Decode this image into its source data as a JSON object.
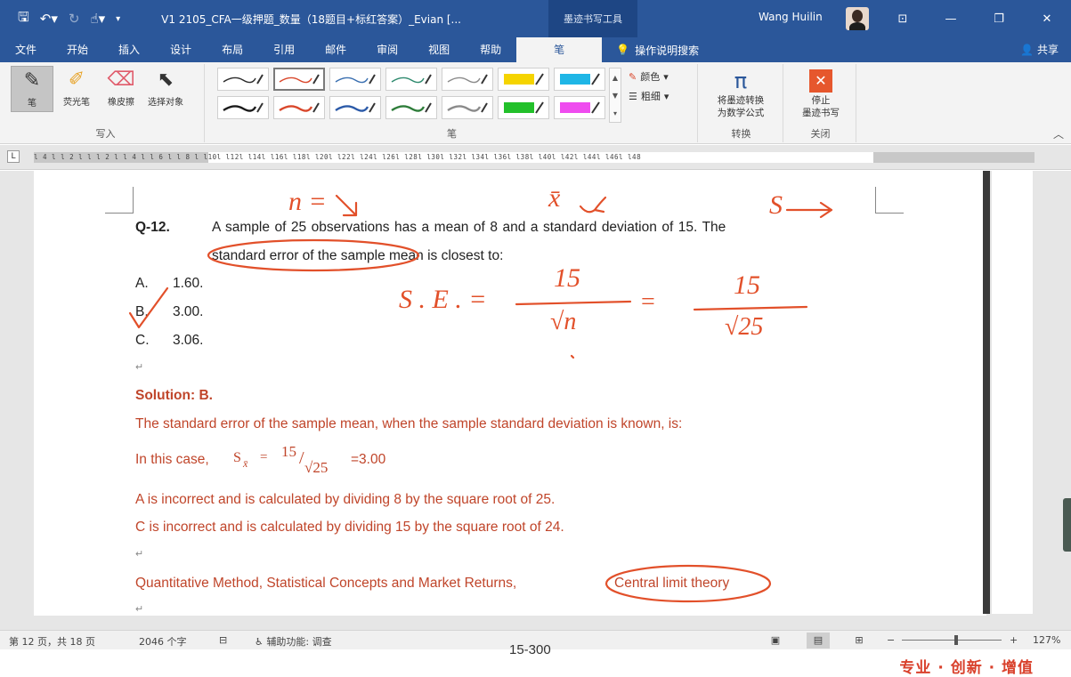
{
  "window": {
    "doc_title": "V1 2105_CFA一级押题_数量（18题目+标红答案）_Evian [...",
    "context_tab": "墨迹书写工具",
    "user_name": "Wang Huilin",
    "share": "共享",
    "tell_me": "操作说明搜索"
  },
  "tabs": [
    "文件",
    "开始",
    "插入",
    "设计",
    "布局",
    "引用",
    "邮件",
    "审阅",
    "视图",
    "帮助",
    "笔"
  ],
  "active_tab": "笔",
  "ribbon": {
    "write_group": {
      "label": "写入",
      "tools": [
        "笔",
        "荧光笔",
        "橡皮擦",
        "选择对象"
      ]
    },
    "pens_group": {
      "label": "笔",
      "color_label": "颜色",
      "thickness_label": "粗细",
      "pen_colors": [
        "#2b2b2b",
        "#d9472b",
        "#3a6fb0",
        "#2e8a6e",
        "#8a8a8a",
        "#f5d400",
        "#1fb6e6",
        "#1a1a1a",
        "#d9472b",
        "#2b5aa8",
        "#2e7d3a",
        "#8a8a8a",
        "#22c02a",
        "#ef4cef"
      ]
    },
    "convert_group": {
      "label": "转换",
      "button_line1": "将墨迹转换",
      "button_line2": "为数学公式"
    },
    "close_group": {
      "label": "关闭",
      "button_line1": "停止",
      "button_line2": "墨迹书写"
    }
  },
  "ruler_text": "l 4 l  l 2 l  l    l 2 l  l 4 l  l 6 l  l 8 l  l10l  l12l  l14l  l16l  l18l  l20l  l22l  l24l  l26l  l28l  l30l  l32l  l34l  l36l  l38l  l40l  l42l  l44l  l46l  l48",
  "document": {
    "question_number": "Q-12.",
    "question_line1": "A sample of 25 observations has a mean of 8 and a standard deviation of 15. The",
    "question_line2": "standard error of the sample mean is closest to:",
    "options": [
      {
        "letter": "A.",
        "value": "1.60."
      },
      {
        "letter": "B.",
        "value": "3.00."
      },
      {
        "letter": "C.",
        "value": "3.06."
      }
    ],
    "solution_heading": "Solution: B.",
    "solution_line1": "The standard error of the sample mean, when the sample standard deviation is known, is:",
    "case_prefix": "In this case,",
    "case_symbol": "S",
    "case_sub": "x̄",
    "case_eq": "=",
    "case_num": "15",
    "case_slash": "/",
    "case_den": "√25",
    "case_result": "=3.00",
    "line_a": "A is incorrect and is calculated by dividing 8 by the square root of 25.",
    "line_c": "C is incorrect and is calculated by dividing 15 by the square root of 24.",
    "topic_prefix": "Quantitative Method, Statistical Concepts and Market Returns,",
    "topic_highlight": "Central limit theory",
    "para_mark": "↵"
  },
  "ink_text": {
    "n_label": "n =",
    "xbar_label": "x̄",
    "s_label": "S",
    "se_label": "S . E . =",
    "num1": "15",
    "den1": "√n",
    "eq2": "=",
    "num2": "15",
    "den2": "√25"
  },
  "status": {
    "page": "第 12 页，共 18 页",
    "words": "2046 个字",
    "accessibility": "辅助功能: 调查",
    "zoom": "127%"
  },
  "footer": {
    "page_range": "15-300",
    "slogan": "专业 · 创新 · 增值"
  },
  "colors": {
    "title_bar": "#2b579a",
    "ink": "#e2502a",
    "solution_text": "#c0452a"
  }
}
